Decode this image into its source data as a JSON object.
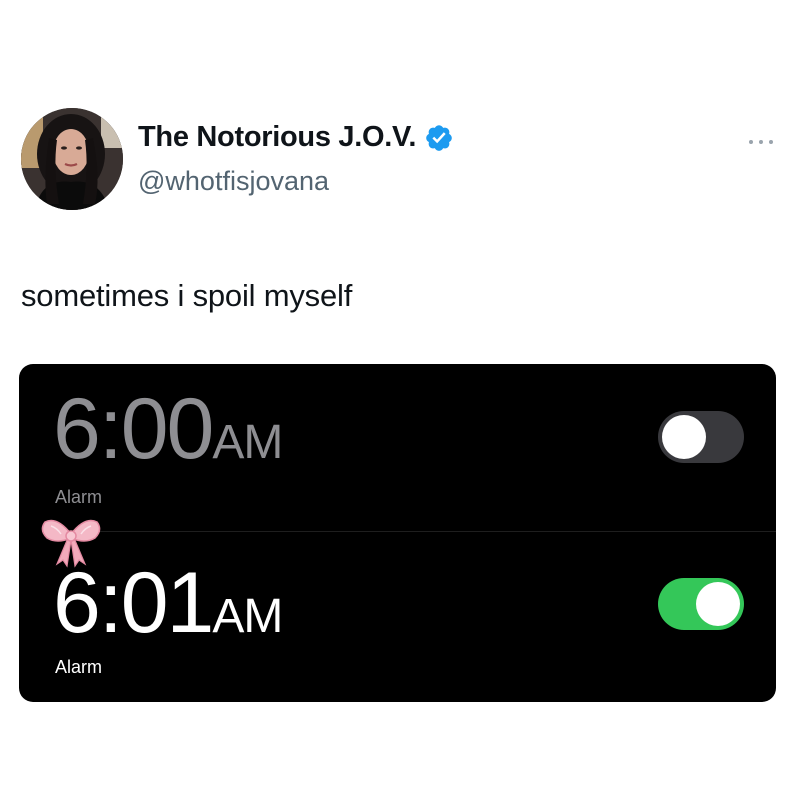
{
  "tweet": {
    "author": {
      "display_name": "The Notorious J.O.V.",
      "handle": "@whotfisjovana",
      "verified": true,
      "avatar_icon": "profile-photo"
    },
    "more_icon": "ellipsis-icon",
    "text": "sometimes i spoil myself"
  },
  "media": {
    "alarms": [
      {
        "time": "6:00",
        "period": "AM",
        "label": "Alarm",
        "enabled": false
      },
      {
        "time": "6:01",
        "period": "AM",
        "label": "Alarm",
        "enabled": true
      }
    ],
    "decoration_icon": "pink-bow-icon"
  },
  "colors": {
    "verified_blue": "#1d9bf0",
    "toggle_on": "#34c759",
    "toggle_off": "#39393d",
    "handle_gray": "#536471"
  }
}
